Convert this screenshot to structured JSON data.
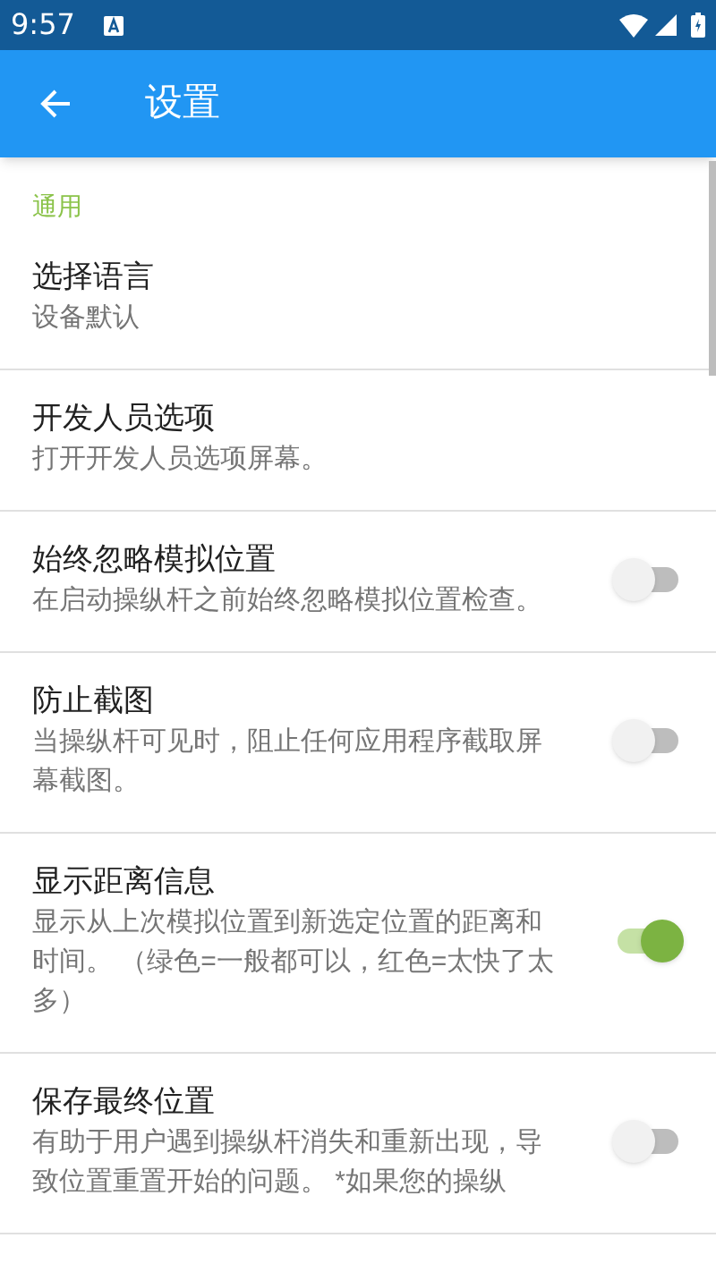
{
  "status_bar": {
    "time": "9:57"
  },
  "app_bar": {
    "title": "设置"
  },
  "section": {
    "title": "通用"
  },
  "items": [
    {
      "kind": "plain",
      "title": "选择语言",
      "summary": "设备默认"
    },
    {
      "kind": "plain",
      "title": "开发人员选项",
      "summary": "打开开发人员选项屏幕。"
    },
    {
      "kind": "switch",
      "title": "始终忽略模拟位置",
      "summary": "在启动操纵杆之前始终忽略模拟位置检查。",
      "on": false
    },
    {
      "kind": "switch",
      "title": "防止截图",
      "summary": "当操纵杆可见时，阻止任何应用程序截取屏幕截图。",
      "on": false
    },
    {
      "kind": "switch",
      "title": "显示距离信息",
      "summary": "显示从上次模拟位置到新选定位置的距离和时间。 （绿色=一般都可以，红色=太快了太多）",
      "on": true
    },
    {
      "kind": "switch",
      "title": "保存最终位置",
      "summary": "有助于用户遇到操纵杆消失和重新出现，导致位置重置开始的问题。 *如果您的操纵",
      "on": false
    }
  ]
}
